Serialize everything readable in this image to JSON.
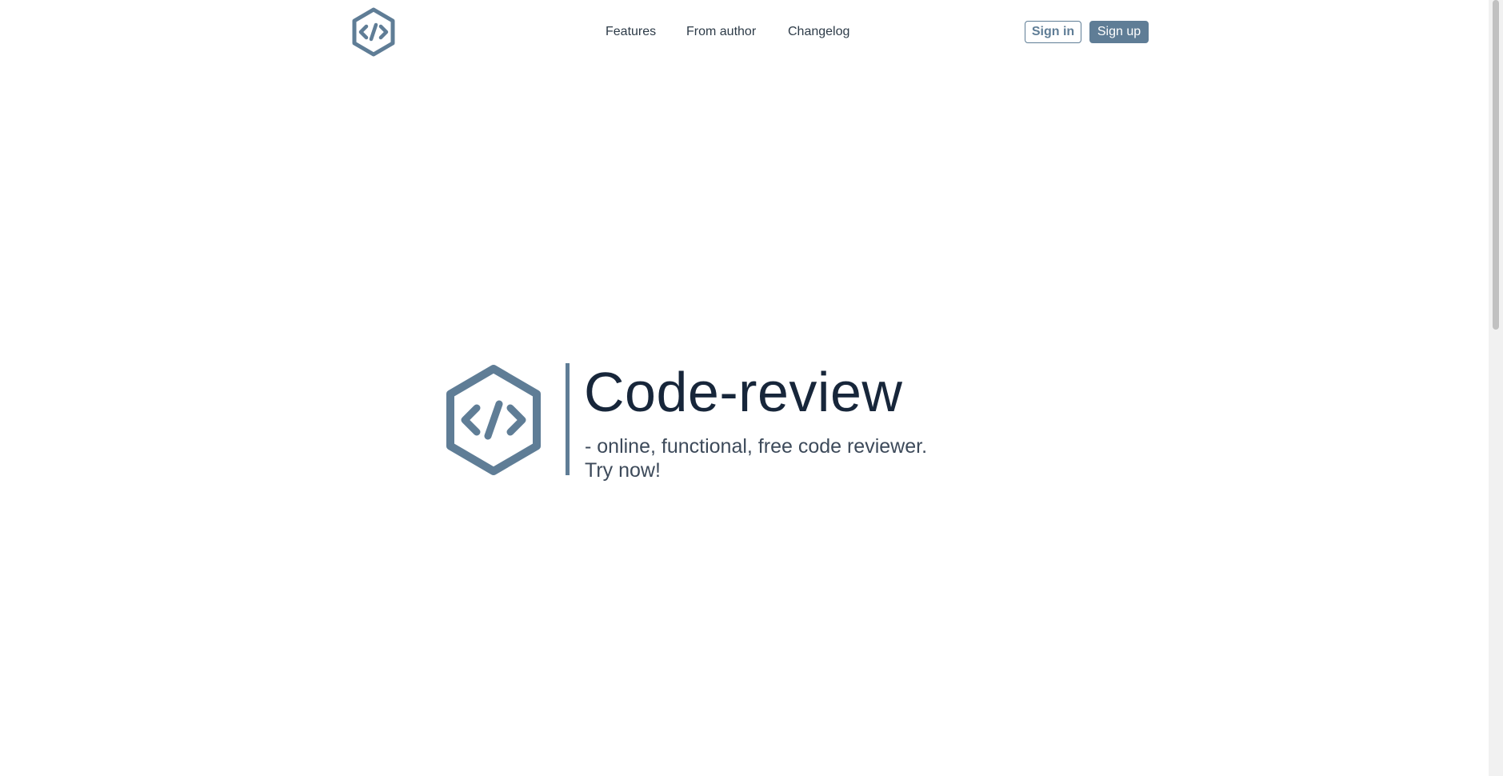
{
  "colors": {
    "brand": "#5f7d96",
    "title_text": "#17263a",
    "nav_text": "#2d3b48"
  },
  "header": {
    "logo_icon": "code-hexagon-icon",
    "nav": [
      {
        "label": "Features"
      },
      {
        "label": "From author"
      },
      {
        "label": "Changelog"
      }
    ],
    "sign_in_label": "Sign in",
    "sign_up_label": "Sign up"
  },
  "hero": {
    "logo_icon": "code-hexagon-icon",
    "title": "Code-review",
    "subtitle_line1": "- online, functional, free code reviewer.",
    "subtitle_line2": "Try now!"
  }
}
